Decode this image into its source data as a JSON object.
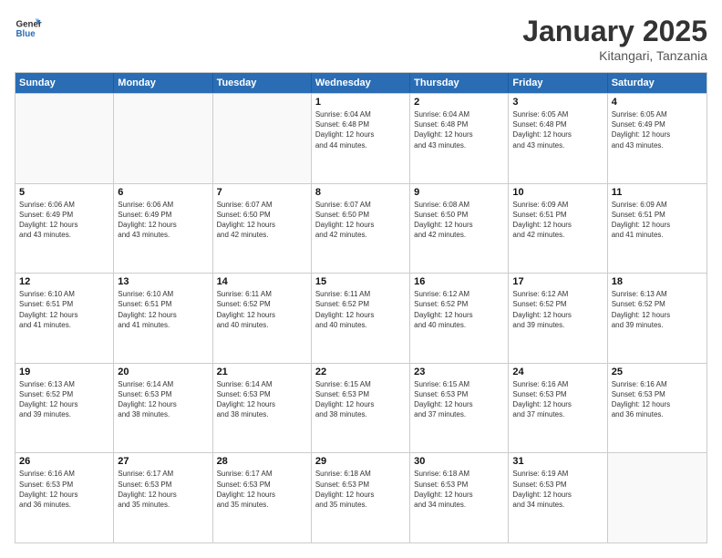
{
  "logo": {
    "line1": "General",
    "line2": "Blue"
  },
  "title": "January 2025",
  "subtitle": "Kitangari, Tanzania",
  "header_days": [
    "Sunday",
    "Monday",
    "Tuesday",
    "Wednesday",
    "Thursday",
    "Friday",
    "Saturday"
  ],
  "weeks": [
    [
      {
        "day": "",
        "info": ""
      },
      {
        "day": "",
        "info": ""
      },
      {
        "day": "",
        "info": ""
      },
      {
        "day": "1",
        "info": "Sunrise: 6:04 AM\nSunset: 6:48 PM\nDaylight: 12 hours\nand 44 minutes."
      },
      {
        "day": "2",
        "info": "Sunrise: 6:04 AM\nSunset: 6:48 PM\nDaylight: 12 hours\nand 43 minutes."
      },
      {
        "day": "3",
        "info": "Sunrise: 6:05 AM\nSunset: 6:48 PM\nDaylight: 12 hours\nand 43 minutes."
      },
      {
        "day": "4",
        "info": "Sunrise: 6:05 AM\nSunset: 6:49 PM\nDaylight: 12 hours\nand 43 minutes."
      }
    ],
    [
      {
        "day": "5",
        "info": "Sunrise: 6:06 AM\nSunset: 6:49 PM\nDaylight: 12 hours\nand 43 minutes."
      },
      {
        "day": "6",
        "info": "Sunrise: 6:06 AM\nSunset: 6:49 PM\nDaylight: 12 hours\nand 43 minutes."
      },
      {
        "day": "7",
        "info": "Sunrise: 6:07 AM\nSunset: 6:50 PM\nDaylight: 12 hours\nand 42 minutes."
      },
      {
        "day": "8",
        "info": "Sunrise: 6:07 AM\nSunset: 6:50 PM\nDaylight: 12 hours\nand 42 minutes."
      },
      {
        "day": "9",
        "info": "Sunrise: 6:08 AM\nSunset: 6:50 PM\nDaylight: 12 hours\nand 42 minutes."
      },
      {
        "day": "10",
        "info": "Sunrise: 6:09 AM\nSunset: 6:51 PM\nDaylight: 12 hours\nand 42 minutes."
      },
      {
        "day": "11",
        "info": "Sunrise: 6:09 AM\nSunset: 6:51 PM\nDaylight: 12 hours\nand 41 minutes."
      }
    ],
    [
      {
        "day": "12",
        "info": "Sunrise: 6:10 AM\nSunset: 6:51 PM\nDaylight: 12 hours\nand 41 minutes."
      },
      {
        "day": "13",
        "info": "Sunrise: 6:10 AM\nSunset: 6:51 PM\nDaylight: 12 hours\nand 41 minutes."
      },
      {
        "day": "14",
        "info": "Sunrise: 6:11 AM\nSunset: 6:52 PM\nDaylight: 12 hours\nand 40 minutes."
      },
      {
        "day": "15",
        "info": "Sunrise: 6:11 AM\nSunset: 6:52 PM\nDaylight: 12 hours\nand 40 minutes."
      },
      {
        "day": "16",
        "info": "Sunrise: 6:12 AM\nSunset: 6:52 PM\nDaylight: 12 hours\nand 40 minutes."
      },
      {
        "day": "17",
        "info": "Sunrise: 6:12 AM\nSunset: 6:52 PM\nDaylight: 12 hours\nand 39 minutes."
      },
      {
        "day": "18",
        "info": "Sunrise: 6:13 AM\nSunset: 6:52 PM\nDaylight: 12 hours\nand 39 minutes."
      }
    ],
    [
      {
        "day": "19",
        "info": "Sunrise: 6:13 AM\nSunset: 6:52 PM\nDaylight: 12 hours\nand 39 minutes."
      },
      {
        "day": "20",
        "info": "Sunrise: 6:14 AM\nSunset: 6:53 PM\nDaylight: 12 hours\nand 38 minutes."
      },
      {
        "day": "21",
        "info": "Sunrise: 6:14 AM\nSunset: 6:53 PM\nDaylight: 12 hours\nand 38 minutes."
      },
      {
        "day": "22",
        "info": "Sunrise: 6:15 AM\nSunset: 6:53 PM\nDaylight: 12 hours\nand 38 minutes."
      },
      {
        "day": "23",
        "info": "Sunrise: 6:15 AM\nSunset: 6:53 PM\nDaylight: 12 hours\nand 37 minutes."
      },
      {
        "day": "24",
        "info": "Sunrise: 6:16 AM\nSunset: 6:53 PM\nDaylight: 12 hours\nand 37 minutes."
      },
      {
        "day": "25",
        "info": "Sunrise: 6:16 AM\nSunset: 6:53 PM\nDaylight: 12 hours\nand 36 minutes."
      }
    ],
    [
      {
        "day": "26",
        "info": "Sunrise: 6:16 AM\nSunset: 6:53 PM\nDaylight: 12 hours\nand 36 minutes."
      },
      {
        "day": "27",
        "info": "Sunrise: 6:17 AM\nSunset: 6:53 PM\nDaylight: 12 hours\nand 35 minutes."
      },
      {
        "day": "28",
        "info": "Sunrise: 6:17 AM\nSunset: 6:53 PM\nDaylight: 12 hours\nand 35 minutes."
      },
      {
        "day": "29",
        "info": "Sunrise: 6:18 AM\nSunset: 6:53 PM\nDaylight: 12 hours\nand 35 minutes."
      },
      {
        "day": "30",
        "info": "Sunrise: 6:18 AM\nSunset: 6:53 PM\nDaylight: 12 hours\nand 34 minutes."
      },
      {
        "day": "31",
        "info": "Sunrise: 6:19 AM\nSunset: 6:53 PM\nDaylight: 12 hours\nand 34 minutes."
      },
      {
        "day": "",
        "info": ""
      }
    ]
  ]
}
